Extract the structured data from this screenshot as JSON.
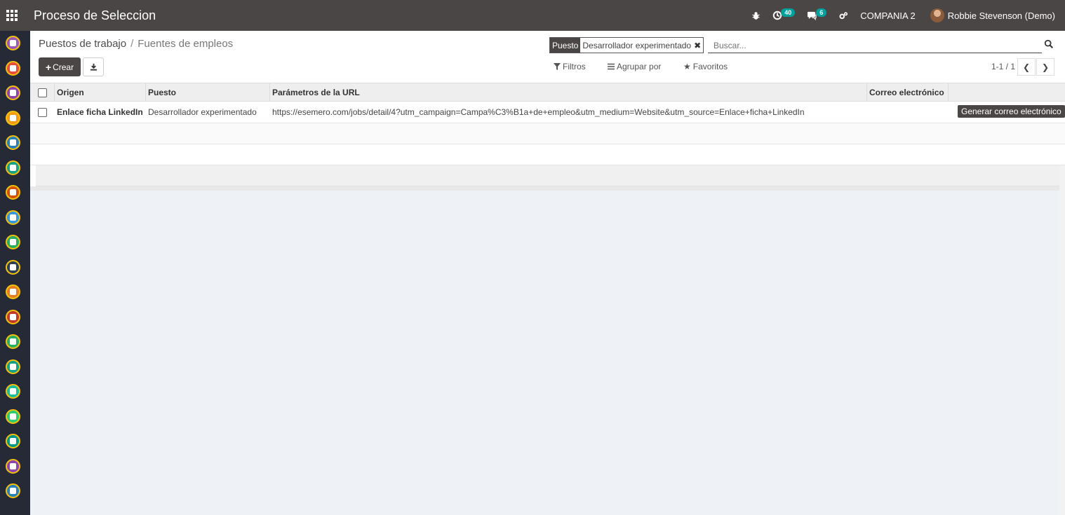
{
  "navbar": {
    "app_title": "Proceso de Seleccion",
    "activity_count": "40",
    "message_count": "6",
    "company": "COMPANIA 2",
    "user": "Robbie Stevenson (Demo)"
  },
  "sidebar": {
    "icons": [
      {
        "name": "recruitment-app-icon",
        "color": "#9b59b6"
      },
      {
        "name": "calendar-app-icon",
        "color": "#e74c3c"
      },
      {
        "name": "notes-app-icon",
        "color": "#8e44ad"
      },
      {
        "name": "contacts-app-icon",
        "color": "#f39c12"
      },
      {
        "name": "crm-app-icon",
        "color": "#2980b9"
      },
      {
        "name": "project-app-icon",
        "color": "#16a085"
      },
      {
        "name": "documents-app-icon",
        "color": "#d35400"
      },
      {
        "name": "sales-app-icon",
        "color": "#3498db"
      },
      {
        "name": "dashboard-app-icon",
        "color": "#27ae60"
      },
      {
        "name": "employees-app-icon",
        "color": "#2c3e50"
      },
      {
        "name": "timeoff-app-icon",
        "color": "#e67e22"
      },
      {
        "name": "inventory-app-icon",
        "color": "#c0392b"
      },
      {
        "name": "website-app-icon",
        "color": "#27ae60"
      },
      {
        "name": "expenses-app-icon",
        "color": "#16a085"
      },
      {
        "name": "invoicing-app-icon",
        "color": "#1abc9c"
      },
      {
        "name": "survey-app-icon",
        "color": "#2ecc71"
      },
      {
        "name": "events-app-icon",
        "color": "#009688"
      },
      {
        "name": "fleet-app-icon",
        "color": "#8e44ad"
      },
      {
        "name": "settings-app-icon",
        "color": "#2980b9"
      }
    ]
  },
  "breadcrumb": {
    "parent": "Puestos de trabajo",
    "separator": "/",
    "current": "Fuentes de empleos"
  },
  "toolbar": {
    "create_label": "Crear"
  },
  "search": {
    "facet_label": "Puesto",
    "facet_value": "Desarrollador experimentado",
    "placeholder": "Buscar..."
  },
  "filters": {
    "filters_label": "Filtros",
    "group_by_label": "Agrupar por",
    "favorites_label": "Favoritos"
  },
  "pager": {
    "value": "1-1 / 1"
  },
  "table": {
    "columns": [
      "Origen",
      "Puesto",
      "Parámetros de la URL",
      "Correo electrónico"
    ],
    "rows": [
      {
        "origen": "Enlace ficha LinkedIn",
        "puesto": "Desarrollador experimentado",
        "url": "https://esemero.com/jobs/detail/4?utm_campaign=Campa%C3%B1a+de+empleo&utm_medium=Website&utm_source=Enlace+ficha+LinkedIn",
        "email": "",
        "action_label": "Generar correo electrónico"
      }
    ]
  }
}
